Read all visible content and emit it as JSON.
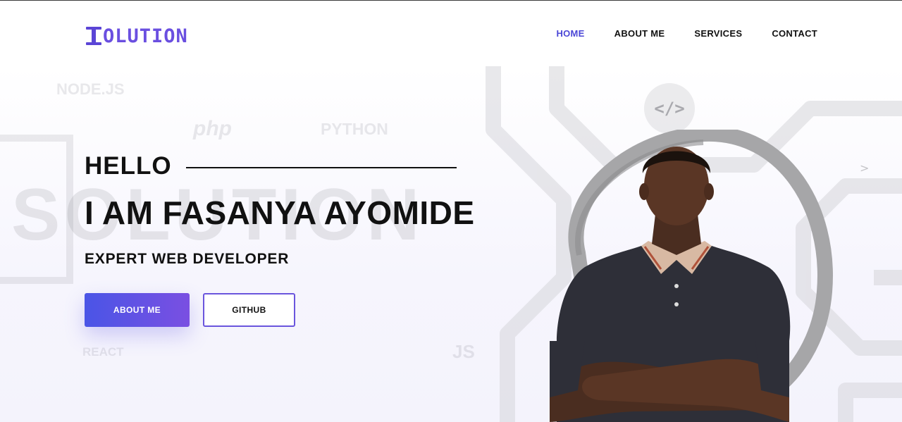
{
  "header": {
    "logo_text": "OLUTION",
    "nav": [
      {
        "label": "HOME",
        "active": true
      },
      {
        "label": "ABOUT ME",
        "active": false
      },
      {
        "label": "SERVICES",
        "active": false
      },
      {
        "label": "CONTACT",
        "active": false
      }
    ]
  },
  "hero": {
    "watermarks": {
      "node": "NODE.JS",
      "php": "php",
      "python": "PYTHON",
      "react": "REACT",
      "js": "JS",
      "big": "SOLUTION"
    },
    "hello": "HELLO",
    "name": "I AM FASANYA AYOMIDE",
    "role": "EXPERT WEB DEVELOPER",
    "about_button": "ABOUT ME",
    "github_button": "GITHUB"
  },
  "colors": {
    "accent": "#4b47d6",
    "logo": "#6a4fe0",
    "button_gradient_start": "#4a55e6",
    "button_gradient_end": "#7a4fe2"
  },
  "icons": [
    "code-icon",
    "logo-icon"
  ]
}
